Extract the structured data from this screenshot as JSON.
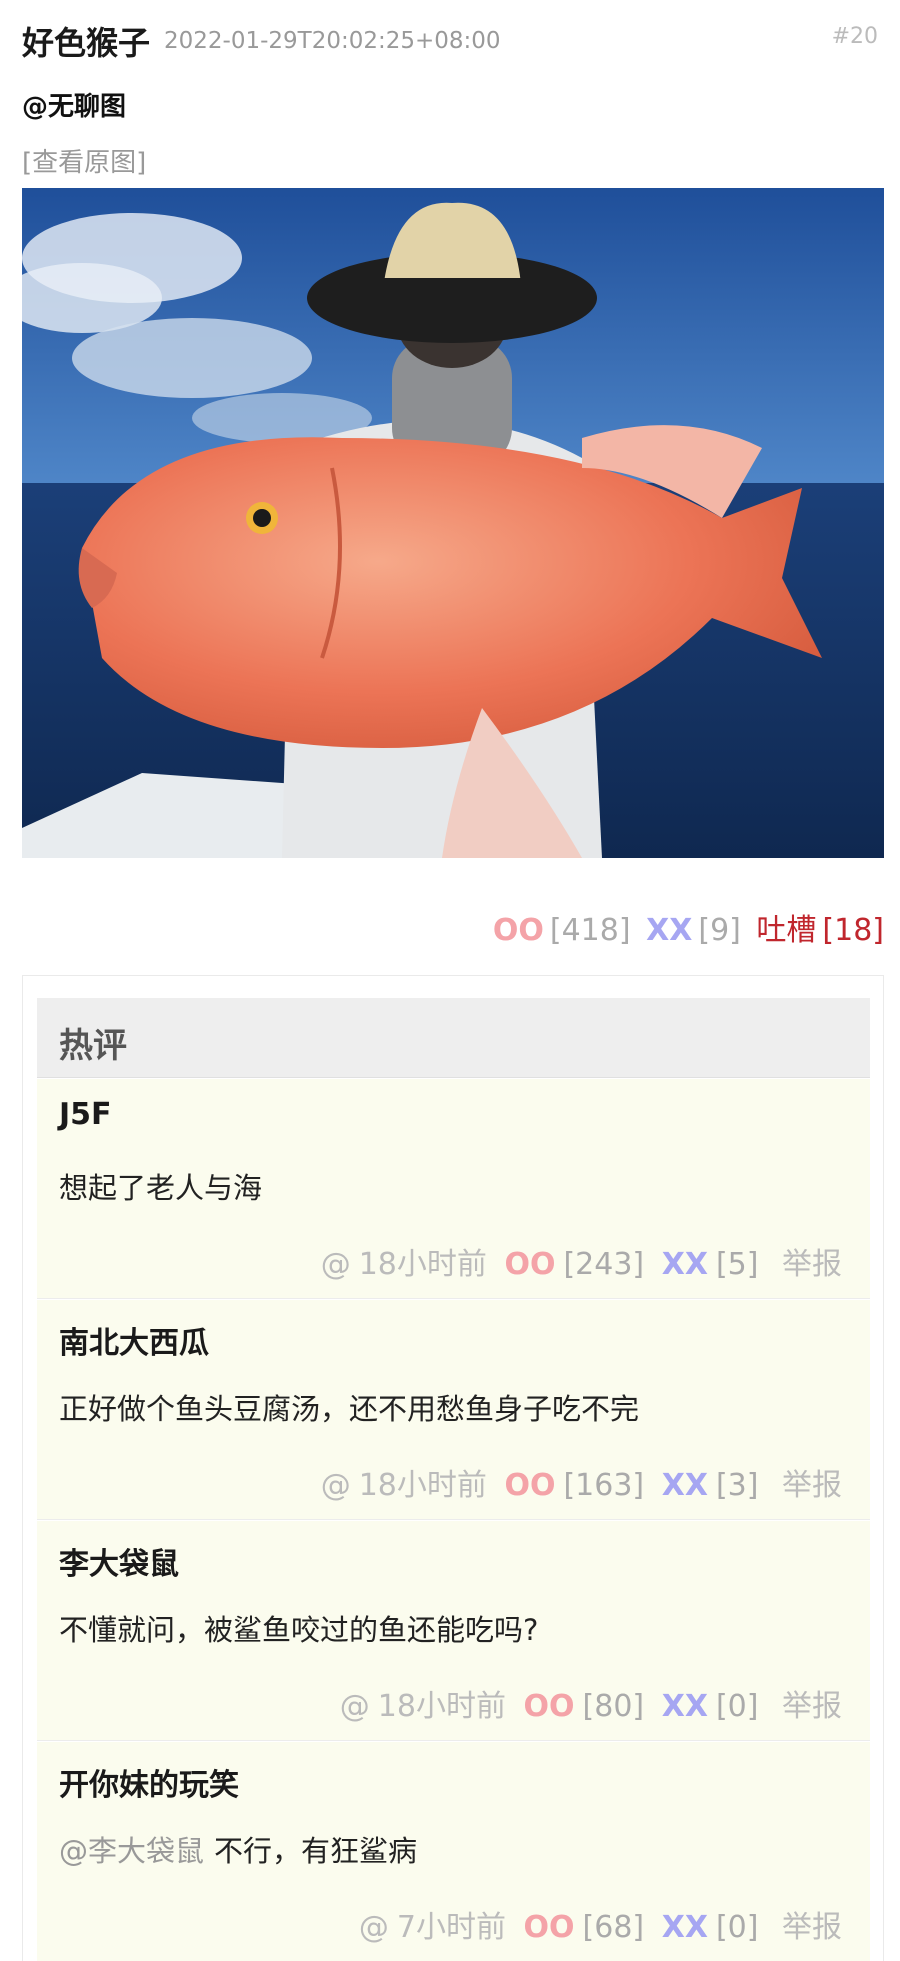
{
  "post": {
    "author": "好色猴子",
    "timestamp": "2022-01-29T20:02:25+08:00",
    "post_number": "#20",
    "mention": "@无聊图",
    "view_original": "[查看原图]"
  },
  "votes": {
    "oo_label": "OO",
    "oo_count": "[418]",
    "xx_label": "XX",
    "xx_count": "[9]",
    "tucao_label": "吐槽",
    "tucao_count": "[18]"
  },
  "hot_comments": {
    "title": "热评",
    "items": [
      {
        "author": "J5F",
        "reply_to": "",
        "text": "想起了老人与海",
        "at": "@",
        "time": "18小时前",
        "oo_label": "OO",
        "oo_count": "[243]",
        "xx_label": "XX",
        "xx_count": "[5]",
        "report": "举报"
      },
      {
        "author": "南北大西瓜",
        "reply_to": "",
        "text": "正好做个鱼头豆腐汤，还不用愁鱼身子吃不完",
        "at": "@",
        "time": "18小时前",
        "oo_label": "OO",
        "oo_count": "[163]",
        "xx_label": "XX",
        "xx_count": "[3]",
        "report": "举报"
      },
      {
        "author": "李大袋鼠",
        "reply_to": "",
        "text": "不懂就问，被鲨鱼咬过的鱼还能吃吗?",
        "at": "@",
        "time": "18小时前",
        "oo_label": "OO",
        "oo_count": "[80]",
        "xx_label": "XX",
        "xx_count": "[0]",
        "report": "举报"
      },
      {
        "author": "开你妹的玩笑",
        "reply_to": "@李大袋鼠",
        "text": "不行，有狂鲨病",
        "at": "@",
        "time": "7小时前",
        "oo_label": "OO",
        "oo_count": "[68]",
        "xx_label": "XX",
        "xx_count": "[0]",
        "report": "举报"
      }
    ]
  },
  "colors": {
    "oo": "#f4a3a8",
    "xx": "#a6a6f2",
    "tucao": "#c0262d",
    "comment_bg": "#fbfcee",
    "hot_header_bg": "#eeeeee"
  }
}
